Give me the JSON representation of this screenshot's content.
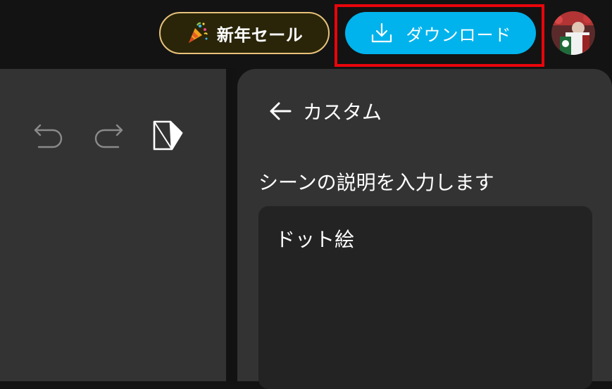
{
  "header": {
    "sale_button_label": "新年セール",
    "sale_icon": "party-popper-icon",
    "download_button_label": "ダウンロード",
    "download_icon": "download-icon",
    "avatar": "user-avatar",
    "colors": {
      "download_accent": "#00b3ec",
      "sale_border": "#e7c27a",
      "highlight_box": "#e8050b"
    }
  },
  "toolbar": {
    "icons": [
      "undo-icon",
      "redo-icon",
      "page-corner-icon"
    ]
  },
  "panel": {
    "back_label": "カスタム",
    "scene_label": "シーンの説明を入力します",
    "scene_value": "ドット絵"
  }
}
